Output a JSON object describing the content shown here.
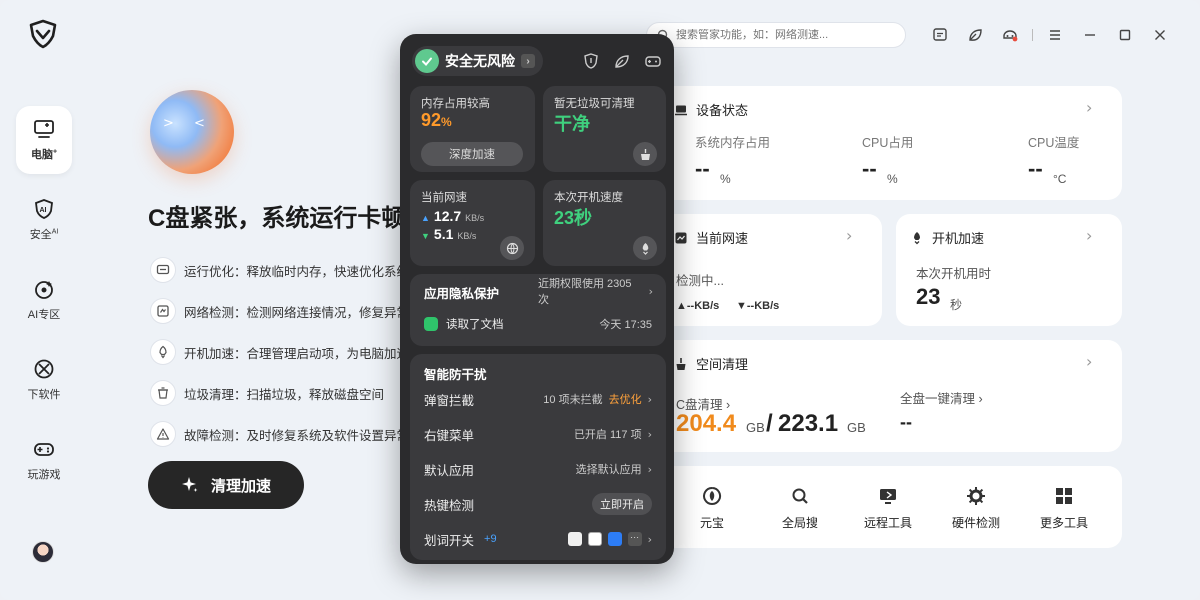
{
  "sidebar": {
    "items": [
      {
        "label": "电脑",
        "sup": "+"
      },
      {
        "label": "安全",
        "sup": "AI"
      },
      {
        "label": "AI专区",
        "sup": ""
      },
      {
        "label": "下软件",
        "sup": ""
      },
      {
        "label": "玩游戏",
        "sup": ""
      }
    ]
  },
  "hero": {
    "orb_face": "> <",
    "title": "C盘紧张，系统运行卡顿",
    "features": [
      "运行优化：释放临时内存，快速优化系统",
      "网络检测：检测网络连接情况，修复异常网络",
      "开机加速：合理管理启动项，为电脑加速",
      "垃圾清理：扫描垃圾，释放磁盘空间",
      "故障检测：及时修复系统及软件设置异常"
    ],
    "cta_label": "清理加速"
  },
  "topbar": {
    "search_placeholder": "搜索管家功能，如：网络测速..."
  },
  "popup": {
    "status": "安全无风险",
    "memory": {
      "title": "内存占用较高",
      "value": "92",
      "unit": "%",
      "button": "深度加速"
    },
    "junk": {
      "title": "暂无垃圾可清理",
      "value": "干净"
    },
    "network": {
      "title": "当前网速",
      "up": "12.7",
      "up_unit": "KB/s",
      "down": "5.1",
      "down_unit": "KB/s"
    },
    "boot": {
      "title": "本次开机速度",
      "value": "23秒"
    },
    "privacy": {
      "title": "应用隐私保护",
      "summary": "近期权限使用 2305 次",
      "event": "读取了文档",
      "event_time": "今天 17:35"
    },
    "anti": {
      "title": "智能防干扰",
      "popup_block": {
        "label": "弹窗拦截",
        "status": "10 项未拦截",
        "action": "去优化"
      },
      "context_menu": {
        "label": "右键菜单",
        "status": "已开启 117 项"
      },
      "default_app": {
        "label": "默认应用",
        "status": "选择默认应用"
      },
      "hotkey": {
        "label": "热键检测",
        "action": "立即开启"
      },
      "word_switch": {
        "label": "划词开关",
        "badge": "+9",
        "more": "···"
      }
    }
  },
  "device": {
    "title": "设备状态",
    "mem_label": "系统内存占用",
    "mem_val": "--",
    "mem_unit": "%",
    "cpu_label": "CPU占用",
    "cpu_val": "--",
    "cpu_unit": "%",
    "temp_label": "CPU温度",
    "temp_val": "--",
    "temp_unit": "°C"
  },
  "network_card": {
    "title": "当前网速",
    "status": "检测中...",
    "up": "▲--KB/s",
    "down": "▼--KB/s"
  },
  "boot_card": {
    "title": "开机加速",
    "label": "本次开机用时",
    "value": "23",
    "unit": "秒"
  },
  "space": {
    "title": "空间清理",
    "c_label": "C盘清理 ›",
    "c_used": "204.4",
    "c_used_unit": "GB",
    "sep": "/",
    "c_total": "223.1",
    "c_total_unit": "GB",
    "all_label": "全盘一键清理 ›",
    "all_val": "--"
  },
  "tools": [
    "元宝",
    "全局搜",
    "远程工具",
    "硬件检测",
    "更多工具"
  ],
  "colors": {
    "accent_orange": "#f08a1c",
    "accent_green": "#3ccf7a",
    "dark_bg": "#2b2b2d"
  }
}
